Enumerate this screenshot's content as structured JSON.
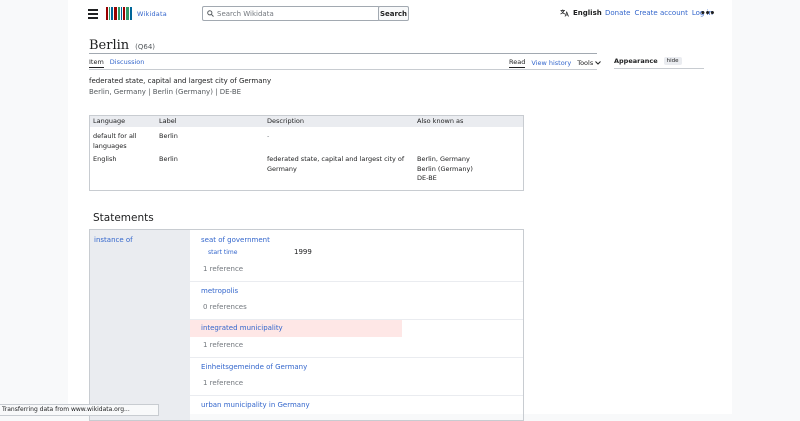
{
  "header": {
    "logo_text": "Wikidata",
    "search_placeholder": "Search Wikidata",
    "search_button": "Search",
    "language": "English",
    "links": [
      "Donate",
      "Create account",
      "Log in"
    ]
  },
  "entity": {
    "label": "Berlin",
    "qid": "(Q64)",
    "description": "federated state, capital and largest city of Germany",
    "aliases": "Berlin, Germany | Berlin (Germany) | DE-BE"
  },
  "tabs": {
    "left": [
      "Item",
      "Discussion"
    ],
    "right": [
      "Read",
      "View history",
      "Tools"
    ]
  },
  "appearance": {
    "label": "Appearance",
    "hide": "hide"
  },
  "terms_table": {
    "headers": [
      "Language",
      "Label",
      "Description",
      "Also known as"
    ],
    "rows": [
      {
        "language": "default for all languages",
        "label": "Berlin",
        "description": "-",
        "aliases": []
      },
      {
        "language": "English",
        "label": "Berlin",
        "description": "federated state, capital and largest city of Germany",
        "aliases": [
          "Berlin, Germany",
          "Berlin (Germany)",
          "DE-BE"
        ]
      }
    ]
  },
  "statements": {
    "heading": "Statements",
    "property": "instance of",
    "values": [
      {
        "name": "seat of government",
        "qualifier_property": "start time",
        "qualifier_value": "1999",
        "references": "1 reference"
      },
      {
        "name": "metropolis",
        "references": "0 references"
      },
      {
        "name": "integrated municipality",
        "references": "1 reference",
        "highlighted": true
      },
      {
        "name": "Einheitsgemeinde of Germany",
        "references": "1 reference"
      },
      {
        "name": "urban municipality in Germany"
      }
    ]
  },
  "status": "Transferring data from www.wikidata.org...",
  "colors": {
    "link": "#3366cc",
    "highlight": "#fee7e6",
    "table_header": "#eaecf0"
  }
}
